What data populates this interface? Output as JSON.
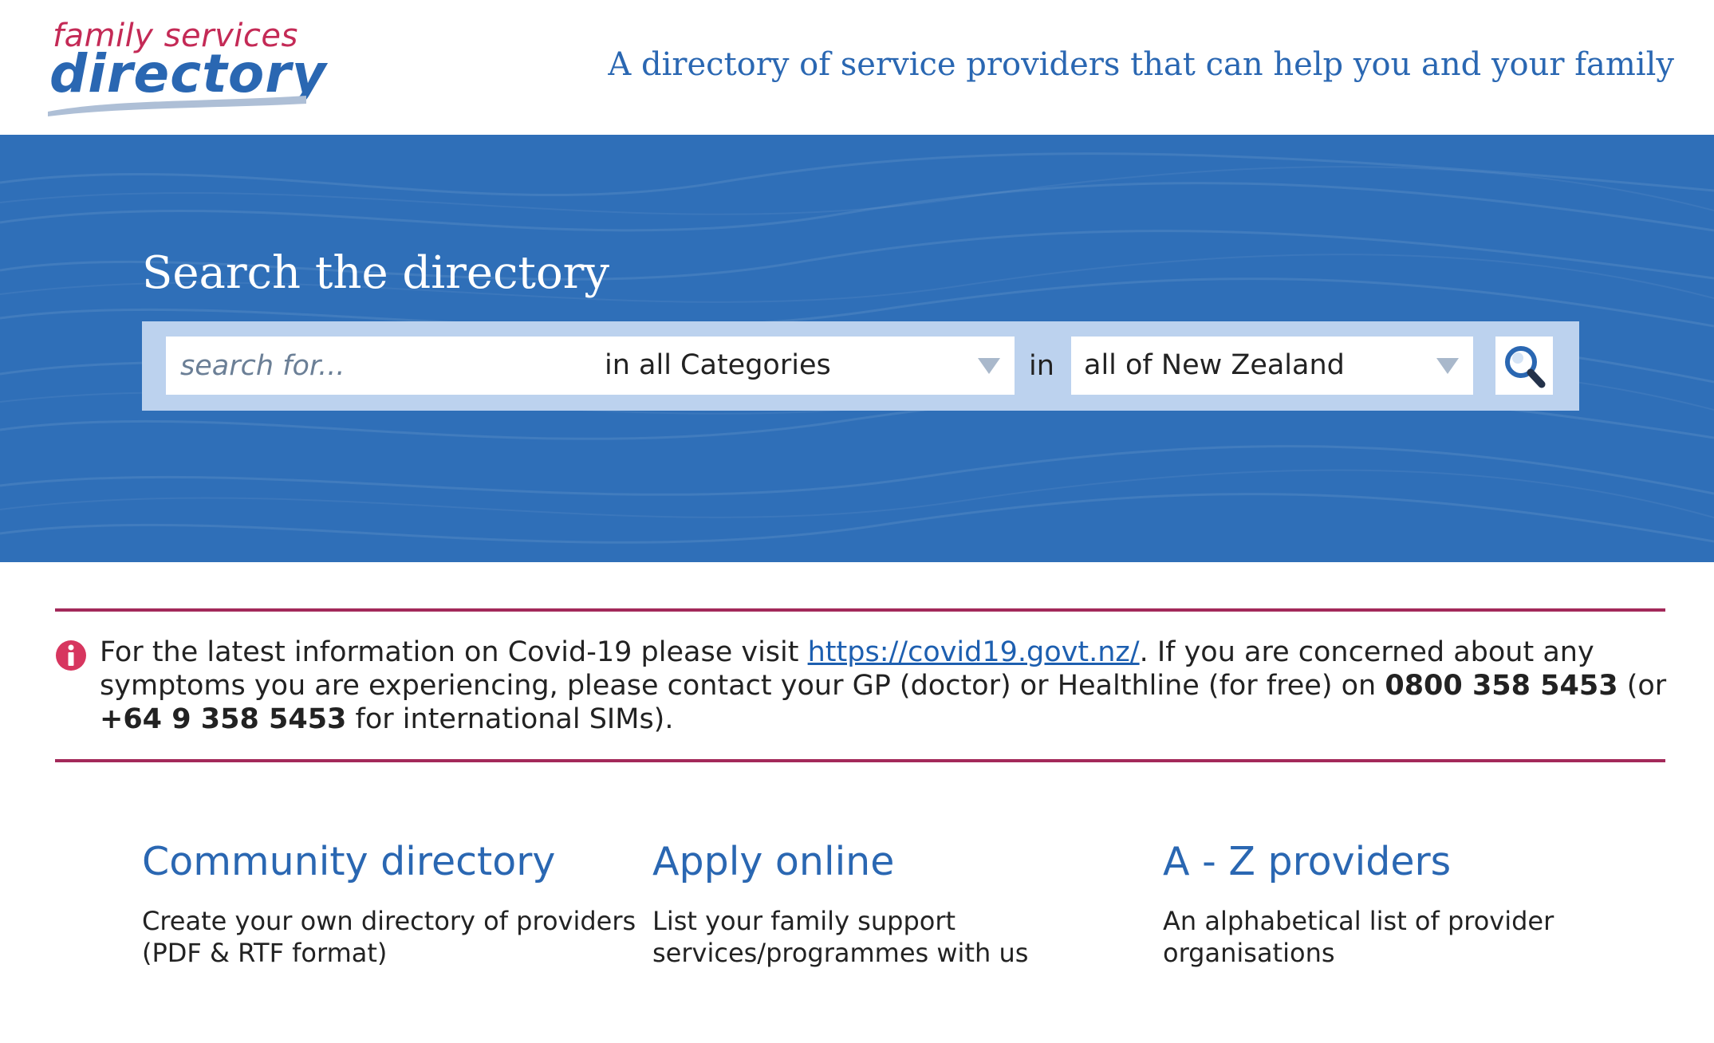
{
  "header": {
    "logo_top": "family services",
    "logo_main": "directory",
    "tagline": "A directory of service providers that can help you and your family"
  },
  "hero": {
    "title": "Search the directory",
    "search_placeholder": "search for...",
    "category_value": "in all Categories",
    "in_label": "in",
    "location_value": "all of New Zealand"
  },
  "notice": {
    "text_1": "For the latest information on Covid-19 please visit ",
    "link": "https://covid19.govt.nz/",
    "text_2": ". If you are concerned about any symptoms you are experiencing, please contact your GP (doctor) or Healthline (for free) on ",
    "phone_1": "0800 358 5453",
    "text_3": " (or ",
    "phone_2": "+64 9 358 5453",
    "text_4": " for international SIMs)."
  },
  "features": [
    {
      "title": "Community directory",
      "desc": "Create your own directory of providers (PDF & RTF format)"
    },
    {
      "title": "Apply online",
      "desc": "List your family support services/programmes with us"
    },
    {
      "title": "A - Z providers",
      "desc": "An alphabetical list of provider organisations"
    }
  ],
  "colors": {
    "brand_blue": "#2a67b2",
    "brand_red": "#c42a56",
    "hero_blue": "#2f6fb8",
    "rule": "#a3295a"
  },
  "icons": {
    "search": "magnifier-icon",
    "info": "info-icon",
    "dropdown": "chevron-down-icon"
  }
}
